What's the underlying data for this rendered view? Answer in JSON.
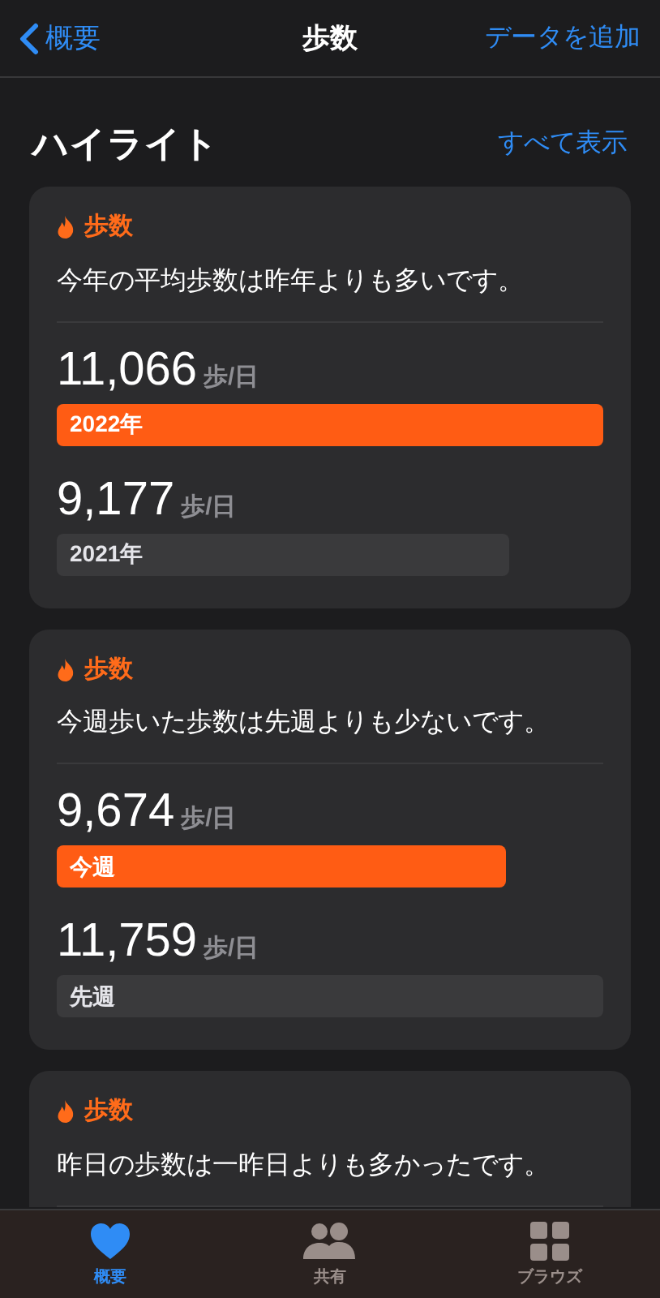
{
  "nav": {
    "back": "概要",
    "title": "歩数",
    "action": "データを追加"
  },
  "section": {
    "title": "ハイライト",
    "link": "すべて表示"
  },
  "cards": [
    {
      "tag": "歩数",
      "sentence": "今年の平均歩数は昨年よりも多いです。",
      "rows": [
        {
          "value": "11,066",
          "unit": "歩/日",
          "label": "2022年",
          "kind": "current"
        },
        {
          "value": "9,177",
          "unit": "歩/日",
          "label": "2021年",
          "kind": "previous"
        }
      ]
    },
    {
      "tag": "歩数",
      "sentence": "今週歩いた歩数は先週よりも少ないです。",
      "rows": [
        {
          "value": "9,674",
          "unit": "歩/日",
          "label": "今週",
          "kind": "current"
        },
        {
          "value": "11,759",
          "unit": "歩/日",
          "label": "先週",
          "kind": "previous"
        }
      ]
    },
    {
      "tag": "歩数",
      "sentence": "昨日の歩数は一昨日よりも多かったです。"
    }
  ],
  "tabs": [
    {
      "label": "概要",
      "selected": true
    },
    {
      "label": "共有",
      "selected": false
    },
    {
      "label": "ブラウズ",
      "selected": false
    }
  ]
}
